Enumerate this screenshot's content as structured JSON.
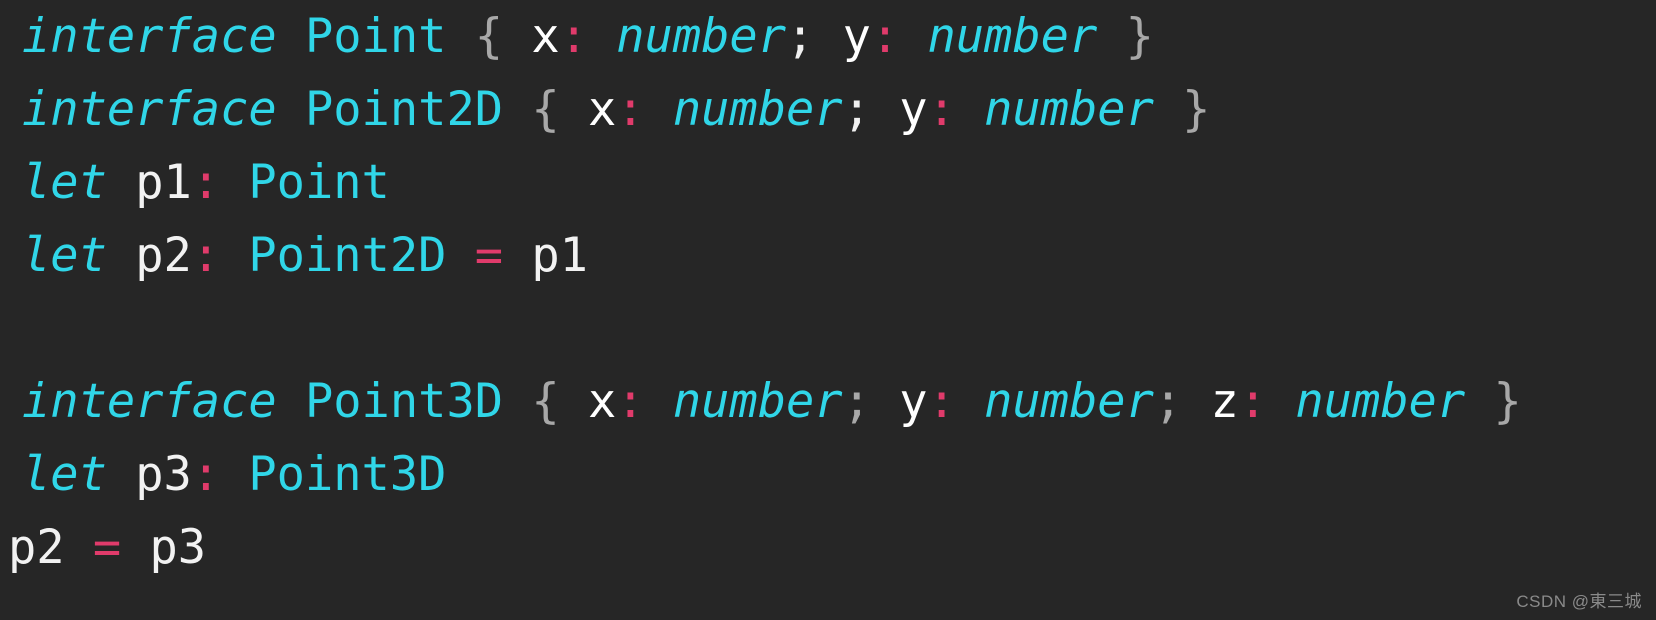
{
  "editor": {
    "background_color": "#262626",
    "font_size_px": 47,
    "line_height_px": 73,
    "language": "typescript"
  },
  "colors": {
    "keyword": "#30D6E8",
    "type": "#30D6E8",
    "builtin_type": "#30D6E8",
    "variable": "#F2F2F2",
    "property": "#FFFFFF",
    "punctuation_colon": "#E03B6B",
    "operator_equals": "#E03B6B",
    "brace": "#A8A8A8",
    "semicolon": "#F0F0F0",
    "background": "#262626",
    "watermark": "#8A8A8A"
  },
  "code": {
    "lines": [
      {
        "id": "line-1",
        "indent": "normal",
        "text": "interface Point { x: number; y: number }",
        "tokens": [
          {
            "t": "interface",
            "c": "keyword"
          },
          {
            "t": " ",
            "c": "space"
          },
          {
            "t": "Point",
            "c": "type"
          },
          {
            "t": " ",
            "c": "space"
          },
          {
            "t": "{",
            "c": "brace"
          },
          {
            "t": " ",
            "c": "space"
          },
          {
            "t": "x",
            "c": "prop"
          },
          {
            "t": ":",
            "c": "punct"
          },
          {
            "t": " ",
            "c": "space"
          },
          {
            "t": "number",
            "c": "builtin"
          },
          {
            "t": ";",
            "c": "semi"
          },
          {
            "t": " ",
            "c": "space"
          },
          {
            "t": "y",
            "c": "prop"
          },
          {
            "t": ":",
            "c": "punct"
          },
          {
            "t": " ",
            "c": "space"
          },
          {
            "t": "number",
            "c": "builtin"
          },
          {
            "t": " ",
            "c": "space"
          },
          {
            "t": "}",
            "c": "brace"
          }
        ]
      },
      {
        "id": "line-2",
        "indent": "normal",
        "text": "interface Point2D { x: number; y: number }",
        "tokens": [
          {
            "t": "interface",
            "c": "keyword"
          },
          {
            "t": " ",
            "c": "space"
          },
          {
            "t": "Point2D",
            "c": "type"
          },
          {
            "t": " ",
            "c": "space"
          },
          {
            "t": "{",
            "c": "brace"
          },
          {
            "t": " ",
            "c": "space"
          },
          {
            "t": "x",
            "c": "prop"
          },
          {
            "t": ":",
            "c": "punct"
          },
          {
            "t": " ",
            "c": "space"
          },
          {
            "t": "number",
            "c": "builtin"
          },
          {
            "t": ";",
            "c": "semi"
          },
          {
            "t": " ",
            "c": "space"
          },
          {
            "t": "y",
            "c": "prop"
          },
          {
            "t": ":",
            "c": "punct"
          },
          {
            "t": " ",
            "c": "space"
          },
          {
            "t": "number",
            "c": "builtin"
          },
          {
            "t": " ",
            "c": "space"
          },
          {
            "t": "}",
            "c": "brace"
          }
        ]
      },
      {
        "id": "line-3",
        "indent": "normal",
        "text": "let p1: Point",
        "tokens": [
          {
            "t": "let",
            "c": "keyword"
          },
          {
            "t": " ",
            "c": "space"
          },
          {
            "t": "p1",
            "c": "var"
          },
          {
            "t": ":",
            "c": "punct"
          },
          {
            "t": " ",
            "c": "space"
          },
          {
            "t": "Point",
            "c": "type"
          }
        ]
      },
      {
        "id": "line-4",
        "indent": "normal",
        "text": "let p2: Point2D = p1",
        "tokens": [
          {
            "t": "let",
            "c": "keyword"
          },
          {
            "t": " ",
            "c": "space"
          },
          {
            "t": "p2",
            "c": "var"
          },
          {
            "t": ":",
            "c": "punct"
          },
          {
            "t": " ",
            "c": "space"
          },
          {
            "t": "Point2D",
            "c": "type"
          },
          {
            "t": " ",
            "c": "space"
          },
          {
            "t": "=",
            "c": "operator"
          },
          {
            "t": " ",
            "c": "space"
          },
          {
            "t": "p1",
            "c": "var"
          }
        ]
      },
      {
        "id": "line-5",
        "indent": "normal",
        "text": "",
        "tokens": []
      },
      {
        "id": "line-6",
        "indent": "normal",
        "text": "interface Point3D { x: number; y: number; z: number }",
        "tokens": [
          {
            "t": "interface",
            "c": "keyword"
          },
          {
            "t": " ",
            "c": "space"
          },
          {
            "t": "Point3D",
            "c": "type"
          },
          {
            "t": " ",
            "c": "space"
          },
          {
            "t": "{",
            "c": "brace"
          },
          {
            "t": " ",
            "c": "space"
          },
          {
            "t": "x",
            "c": "prop"
          },
          {
            "t": ":",
            "c": "punct"
          },
          {
            "t": " ",
            "c": "space"
          },
          {
            "t": "number",
            "c": "builtin"
          },
          {
            "t": ";",
            "c": "semi-dim"
          },
          {
            "t": " ",
            "c": "space"
          },
          {
            "t": "y",
            "c": "prop"
          },
          {
            "t": ":",
            "c": "punct"
          },
          {
            "t": " ",
            "c": "space"
          },
          {
            "t": "number",
            "c": "builtin"
          },
          {
            "t": ";",
            "c": "semi-dim"
          },
          {
            "t": " ",
            "c": "space"
          },
          {
            "t": "z",
            "c": "prop"
          },
          {
            "t": ":",
            "c": "punct"
          },
          {
            "t": " ",
            "c": "space"
          },
          {
            "t": "number",
            "c": "builtin"
          },
          {
            "t": " ",
            "c": "space"
          },
          {
            "t": "}",
            "c": "brace"
          }
        ]
      },
      {
        "id": "line-7",
        "indent": "normal",
        "text": "let p3: Point3D",
        "tokens": [
          {
            "t": "let",
            "c": "keyword"
          },
          {
            "t": " ",
            "c": "space"
          },
          {
            "t": "p3",
            "c": "var"
          },
          {
            "t": ":",
            "c": "punct"
          },
          {
            "t": " ",
            "c": "space"
          },
          {
            "t": "Point3D",
            "c": "type"
          }
        ]
      },
      {
        "id": "line-8",
        "indent": "none",
        "text": "p2 = p3",
        "tokens": [
          {
            "t": "p2",
            "c": "var"
          },
          {
            "t": " ",
            "c": "space"
          },
          {
            "t": "=",
            "c": "operator"
          },
          {
            "t": " ",
            "c": "space"
          },
          {
            "t": "p3",
            "c": "var"
          }
        ]
      }
    ]
  },
  "watermark": {
    "text": "CSDN @東三城"
  }
}
